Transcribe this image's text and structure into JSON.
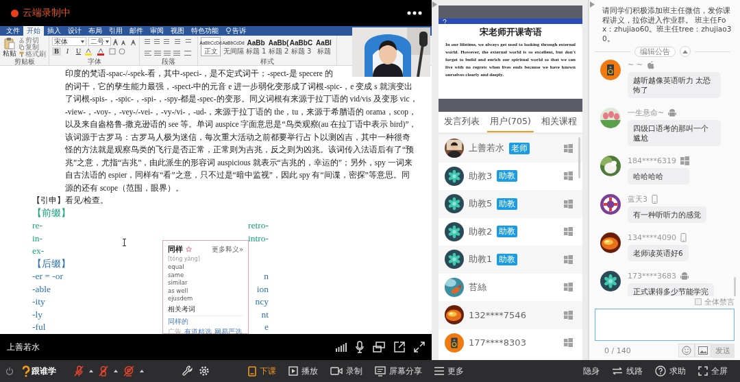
{
  "recording": {
    "status": "云端录制中"
  },
  "word": {
    "tabs": [
      {
        "label": "文件",
        "selected": false
      },
      {
        "label": "开始",
        "selected": true
      },
      {
        "label": "插入",
        "selected": false
      },
      {
        "label": "设计",
        "selected": false
      },
      {
        "label": "布局",
        "selected": false
      },
      {
        "label": "引用",
        "selected": false
      },
      {
        "label": "邮件",
        "selected": false
      },
      {
        "label": "审阅",
        "selected": false
      },
      {
        "label": "视图",
        "selected": false
      },
      {
        "label": "特色功能",
        "selected": false
      }
    ],
    "tell_me": "告诉",
    "clipboard": {
      "paste": "粘贴",
      "actions": [
        "剪切",
        "复制",
        "格式刷"
      ],
      "label": "剪贴板"
    },
    "font": {
      "family": "宋体",
      "size": "二号",
      "buttons": [
        "B",
        "I",
        "U"
      ],
      "label": "字体"
    },
    "paragraph": {
      "label": "段落"
    },
    "styles": {
      "label": "样式",
      "items": [
        {
          "preview": "AaBbCcDd",
          "name": "正文",
          "selected": true
        },
        {
          "preview": "AaBbCcDd",
          "name": "无间隔",
          "selected": false
        },
        {
          "preview": "AaBb",
          "name": "标题 1",
          "selected": false
        },
        {
          "preview": "AaBb(",
          "name": "标题 2",
          "selected": false
        },
        {
          "preview": "AaBbC",
          "name": "标题 3",
          "selected": false
        },
        {
          "preview": "AaBl",
          "name": "标题",
          "selected": false
        }
      ]
    }
  },
  "document": {
    "paragraph": [
      "印度的梵语-spac-/-spek-看，其中-speci-，是不定式词干；-spect-是 specere 的",
      "的词干，它的孳生能力最强，-spect-中的元音 e 进一步弱化变形成了词根-spic-，e 变成 s 就演变出",
      "了词根-spis-，-spic-，-spi-，-spy-都是-spec-的变形。同义词根有来源于拉丁语的 vid/vis 及变形 vic，",
      "-view-，-voy-，-vey-/-vei-，-vy-/vi-，-ud-，来源于拉丁语的 the，tu，来源于希腊语的 orama，scop，",
      "以及来自盎格鲁-撒克逊语的 see 等。单词 auspice 字面意思是“鸟类观察(au 在拉丁语中表示 bird)”，",
      "该词源于古罗马：古罗马人极为迷信，每次重大活动之前都要举行占卜以测凶吉，其中一种很奇",
      "怪的方法就是观察鸟类的飞行是否正常，正常则为吉兆，反之则为凶兆。该词传入法语后有了“预",
      "兆”之意，尤指“吉兆”，由此派生的形容词 auspicious 就表示“吉兆的，幸运的”；另外，spy 一词来",
      "自古法语的 espier，同样有“看”之意，只不过是“暗中监视”，因此 spy 有“间谍，密探”等意思。同",
      "源的还有 scope（范围，眼界）。"
    ],
    "extension": "【引申】看见/检查。",
    "sections": [
      {
        "heading": "【前缀】",
        "color": "#14a37a",
        "rows": [
          {
            "left": "re-",
            "right": "retro-"
          },
          {
            "left": "in-",
            "right": "intro-"
          },
          {
            "left": "ex-"
          }
        ]
      },
      {
        "heading": "【后缀】",
        "color": "#2a72b5",
        "rows": [
          {
            "left": "-er = -or",
            "right": "n"
          },
          {
            "left": "-able",
            "right": "ion"
          },
          {
            "left": "-ity",
            "right": "ncy"
          },
          {
            "left": "-ly",
            "right": "nt"
          },
          {
            "left": "-ful",
            "right": "e"
          }
        ]
      }
    ]
  },
  "dictionary_popup": {
    "word": "同样",
    "more": "更多释义»",
    "pinyin": "[tóng yàng]",
    "meanings": [
      "equal",
      "same",
      "similar",
      "as well",
      "ejusdem"
    ],
    "related_heading": "相关考词",
    "related": "同样的",
    "footer": [
      "广告",
      "有道精选",
      "网易严选"
    ]
  },
  "video": {
    "presenter": "上善若水"
  },
  "banner": {
    "title": "宋老师开课寄语",
    "text_en": "In our lifetime, we always get used to looking through external world. However, the external world is so excellent, but don't forget to build and enrich our spiritual world so that we can live with no regrets when lives ends because we have known ourselves clearly and deeply."
  },
  "panel_tabs": [
    {
      "label": "发言列表",
      "selected": false
    },
    {
      "label": "用户(705)",
      "selected": true
    },
    {
      "label": "相关课程",
      "selected": false
    }
  ],
  "users": [
    {
      "name": "上善若水",
      "role": "老师",
      "avatar": {
        "kind": "person"
      },
      "device": {
        "kind": "windows"
      }
    },
    {
      "name": "助教3",
      "role": "助教",
      "avatar": {
        "kind": "emblem"
      },
      "device": {
        "kind": "windows"
      }
    },
    {
      "name": "助教5",
      "role": "助教",
      "avatar": {
        "kind": "emblem"
      },
      "device": {
        "kind": "windows"
      }
    },
    {
      "name": "助教2",
      "role": "助教",
      "avatar": {
        "kind": "emblem"
      },
      "device": {
        "kind": "windows"
      }
    },
    {
      "name": "助教1",
      "role": "助教",
      "avatar": {
        "kind": "emblem"
      },
      "device": {
        "kind": "windows"
      }
    },
    {
      "name": "苔絲",
      "device": {
        "kind": "windows"
      }
    },
    {
      "name": "132****7546",
      "device": {
        "kind": "windows"
      }
    },
    {
      "name": "177****8303",
      "avatar": {
        "kind": "speaker"
      },
      "device": {
        "kind": "windows"
      }
    }
  ],
  "announcement": {
    "text": "请同学们积极添加班主任微信，发你课程讲义，拉你进入作业群。 班主任Fox：zhujiao60。班主任tree：zhujiao30。",
    "edit": "编辑公告"
  },
  "messages": [
    {
      "name": "~ ~",
      "device": {
        "kind": "apple"
      },
      "avatar": {
        "kind": "speaker"
      },
      "text": "越听越像英语听力 太恐怖了"
    },
    {
      "name": "一生悬命~",
      "device": {
        "kind": "android"
      },
      "text": "四级口语考的那叫一个尴尬"
    },
    {
      "name": "184****6319",
      "device": {
        "kind": "windows"
      },
      "text": "哈哈哈哈"
    },
    {
      "name": "蓝天3",
      "device": {
        "kind": "phone"
      },
      "avatar": {
        "kind": "ring"
      },
      "text": "有一种听听力的感觉"
    },
    {
      "name": "134****4090",
      "device": {
        "kind": "phone"
      },
      "text": "老师读英语好6"
    },
    {
      "name": "173****3683",
      "device": {
        "kind": "android"
      },
      "avatar": {
        "kind": "emblem"
      },
      "text": "正式课得多少节能学完"
    }
  ],
  "mute_all": {
    "label": "全体禁言",
    "checked": false
  },
  "composer": {
    "count": "0 / 140",
    "send": "发送",
    "send_disabled": true
  },
  "toolbar": {
    "logo": "跟谁学",
    "tools": [
      {
        "label": "下课",
        "kind": "end_class"
      },
      {
        "label": "播放",
        "kind": "play"
      },
      {
        "label": "录制",
        "kind": "record"
      },
      {
        "label": "屏幕分享",
        "kind": "share"
      },
      {
        "label": "更多",
        "kind": "more"
      }
    ],
    "right_tools": [
      {
        "label": "隐身",
        "kind": "stealth"
      },
      {
        "label": "线路",
        "kind": "route"
      },
      {
        "label": "求助",
        "kind": "help"
      },
      {
        "label": "全屏",
        "kind": "fullscreen"
      }
    ]
  }
}
